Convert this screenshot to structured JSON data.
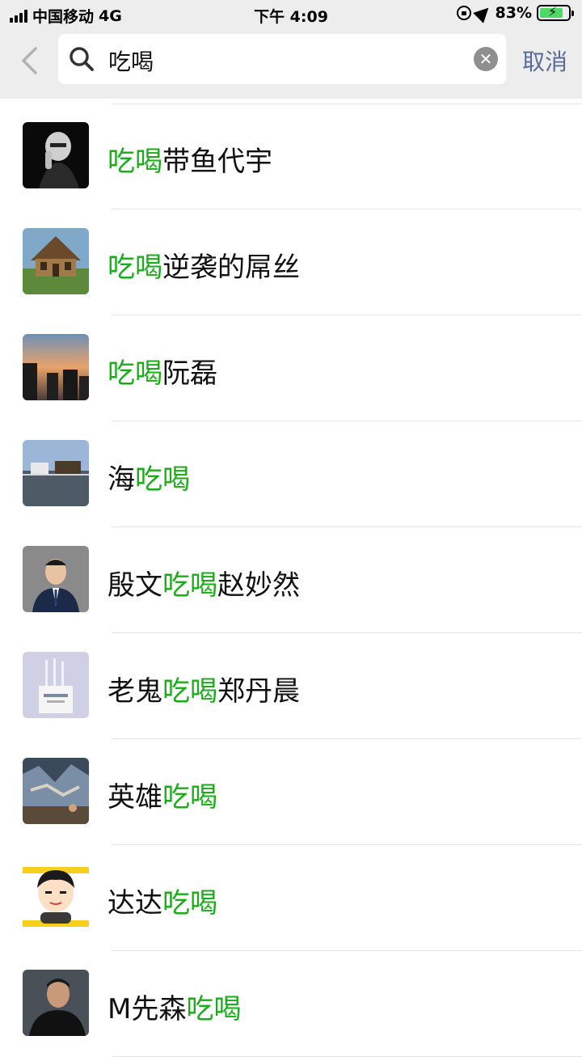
{
  "status_bar": {
    "carrier": "中国移动",
    "network": "4G",
    "time": "下午 4:09",
    "battery": "83%"
  },
  "header": {
    "search_query": "吃喝",
    "cancel_label": "取消"
  },
  "colors": {
    "highlight": "#1aad19",
    "cancel": "#576b95",
    "topbar_bg": "#ededed"
  },
  "results": [
    {
      "pre": "",
      "match": "吃喝",
      "post": "带鱼代宇"
    },
    {
      "pre": "",
      "match": "吃喝",
      "post": "逆袭的屌丝"
    },
    {
      "pre": "",
      "match": "吃喝",
      "post": "阮磊"
    },
    {
      "pre": "海",
      "match": "吃喝",
      "post": ""
    },
    {
      "pre": "殷文",
      "match": "吃喝",
      "post": "赵妙然"
    },
    {
      "pre": "老鬼",
      "match": "吃喝",
      "post": "郑丹晨"
    },
    {
      "pre": "英雄",
      "match": "吃喝",
      "post": ""
    },
    {
      "pre": "达达",
      "match": "吃喝",
      "post": ""
    },
    {
      "pre": "M先森",
      "match": "吃喝",
      "post": ""
    }
  ]
}
